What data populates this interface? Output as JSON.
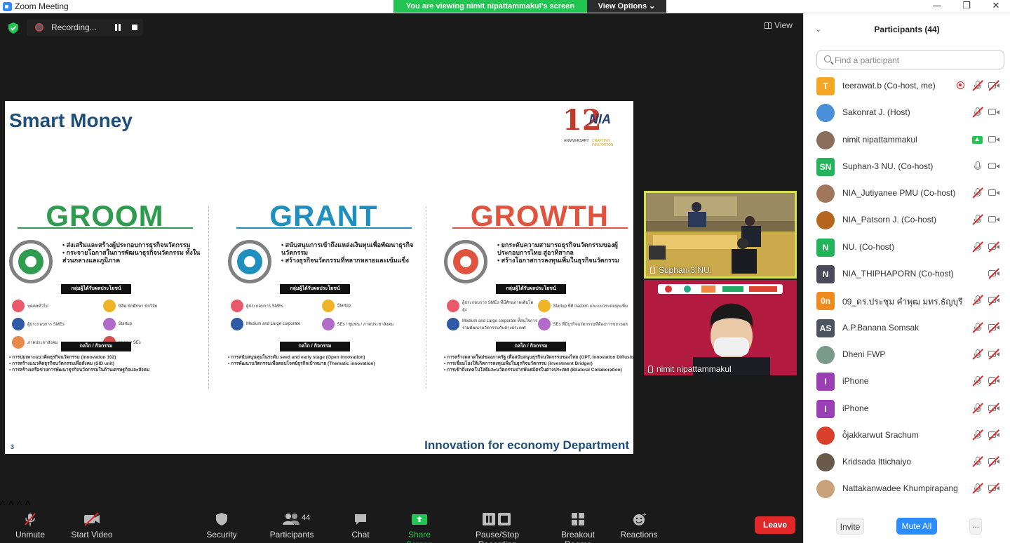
{
  "window": {
    "title": "Zoom Meeting",
    "viewing_banner": "You are viewing nimit nipattammakul's screen",
    "view_options": "View Options ⌄",
    "minimize": "—",
    "maximize": "❐",
    "close": "✕"
  },
  "meeting": {
    "recording_label": "Recording...",
    "view_label": "View"
  },
  "slide": {
    "title": "Smart Money",
    "logo_number": "12",
    "logo_text": "NIA",
    "logo_anniversary": "ANNIVERSARY",
    "logo_tagline": "CRAFTING INNOVATION",
    "slide_number": "3",
    "footer": "Innovation for economy Department",
    "columns": [
      {
        "heading": "GROOM",
        "color": "#2e9b4e",
        "bullets": [
          "ส่งเสริมและสร้างผู้ประกอบการธุรกิจนวัตกรรม",
          "กระจายโอกาสในการพัฒนาธุรกิจนวัตกรรม ทั้งในส่วนกลางและภูมิภาค"
        ],
        "beneficiary_header": "กลุ่มผู้ได้รับผลประโยชน์",
        "beneficiaries": [
          "บุคคลทั่วไป",
          "นิสิต นักศึกษา นักวิจัย",
          "ผู้ประกอบการ SMEs",
          "Startup",
          "ภาคประชาสังคม",
          "ชุมชน / SEs"
        ],
        "mechanism_header": "กลไก / กิจกรรม",
        "mechanisms": [
          "การบ่มเพาะแนวคิดธุรกิจนวัตกรรม (Innovation 102)",
          "การสร้างแนวคิดธุรกิจนวัตกรรมเพื่อสังคม (SID unit)",
          "การสร้างเครือข่ายการพัฒนาธุรกิจนวัตกรรมในด้านเศรษฐกิจและสังคม"
        ]
      },
      {
        "heading": "GRANT",
        "color": "#1f8fbf",
        "bullets": [
          "สนับสนุนการเข้าถึงแหล่งเงินทุนเพื่อพัฒนาธุรกิจนวัตกรรม",
          "สร้างธุรกิจนวัตกรรมที่หลากหลายและเข้มแข็ง"
        ],
        "beneficiary_header": "กลุ่มผู้ได้รับผลประโยชน์",
        "beneficiaries": [
          "ผู้ประกอบการ SMEs",
          "Startup",
          "Medium and Large corporate",
          "SEs / ชุมชน / ภาคประชาสังคม"
        ],
        "mechanism_header": "กลไก / กิจกรรม",
        "mechanisms": [
          "การสนับสนุนทุนในระดับ seed and early stage (Open innovation)",
          "การพัฒนานวัตกรรมเพื่อตอบโจทย์ธุรกิจเป้าหมาย (Thematic innovation)"
        ]
      },
      {
        "heading": "GROWTH",
        "color": "#e0533e",
        "bullets": [
          "ยกระดับความสามารถธุรกิจนวัตกรรมของผู้ประกอบการไทย สู่อาทิสากล",
          "สร้างโอกาสการลงทุนเพิ่มในธุรกิจนวัตกรรม"
        ],
        "beneficiary_header": "กลุ่มผู้ได้รับผลประโยชน์",
        "beneficiaries": [
          "ผู้ประกอบการ SMEs ที่มีศักยภาพเติบโตสูง",
          "Startup ที่มี traction และแนวระดมทุนเพิ่ม",
          "Medium and Large corporate ที่สนใจการร่วมพัฒนานวัตกรรมกับต่างประเทศ",
          "SEs ที่มีธุรกิจนวัตกรรมที่ต้องการขยายผล"
        ],
        "mechanism_header": "กลไก / กิจกรรม",
        "mechanisms": [
          "การสร้างตลาดใหม่ของภาครัฐ เพื่อสนับสนุนธุรกิจนวัตกรรมของไทย (GPT, Innovation Diffusion)",
          "การเชื่อมโยงให้เกิดการลงทุนเพิ่มในธุรกิจนวัตกรรม (Investment Bridger)",
          "การเข้าถึงเทคโนโลยีและนวัตกรรมจากพันธมิตรในต่างประเทศ (Bilateral Collaboration)"
        ]
      }
    ]
  },
  "tiles": [
    {
      "name": "Suphan-3 NU."
    },
    {
      "name": "nimit nipattammakul"
    }
  ],
  "toolbar": {
    "unmute": "Unmute",
    "start_video": "Start Video",
    "security": "Security",
    "participants": "Participants",
    "participants_count": "44",
    "chat": "Chat",
    "share_screen": "Share Screen",
    "pause_stop_recording": "Pause/Stop Recording",
    "breakout_rooms": "Breakout Rooms",
    "reactions": "Reactions",
    "leave": "Leave"
  },
  "participants_panel": {
    "title": "Participants (44)",
    "search_placeholder": "Find a participant",
    "invite": "Invite",
    "mute_all": "Mute All",
    "more": "...",
    "people": [
      {
        "initials": "T",
        "name": "teerawat.b (Co-host, me)",
        "color": "#f5a623",
        "mic": "muted",
        "cam": "off",
        "extra": "record"
      },
      {
        "initials": "",
        "name": "Sakonrat J. (Host)",
        "color": "#4a90d9",
        "mic": "muted",
        "cam": "on",
        "extra": ""
      },
      {
        "initials": "",
        "name": "nimit nipattammakul",
        "color": "#8a6d5a",
        "mic": "share",
        "cam": "on",
        "extra": ""
      },
      {
        "initials": "SN",
        "name": "Suphan-3 NU. (Co-host)",
        "color": "#23b35a",
        "mic": "on",
        "cam": "on",
        "extra": ""
      },
      {
        "initials": "",
        "name": "NIA_Jutiyanee PMU (Co-host)",
        "color": "#a0765c",
        "mic": "muted",
        "cam": "on",
        "extra": ""
      },
      {
        "initials": "",
        "name": "NIA_Patsorn J. (Co-host)",
        "color": "#b5651d",
        "mic": "muted",
        "cam": "on",
        "extra": ""
      },
      {
        "initials": "N",
        "name": "NU. (Co-host)",
        "color": "#23b35a",
        "mic": "muted",
        "cam": "off",
        "extra": ""
      },
      {
        "initials": "N",
        "name": "NIA_THIPHAPORN (Co-host)",
        "color": "#4a4a5a",
        "mic": "none",
        "cam": "off",
        "extra": ""
      },
      {
        "initials": "0n",
        "name": "09_ดร.ประชุม คำพุฒ มทร.ธัญบุรี",
        "color": "#f08a1c",
        "mic": "muted",
        "cam": "off",
        "extra": ""
      },
      {
        "initials": "AS",
        "name": "A.P.Banana Somsak",
        "color": "#4a5560",
        "mic": "muted",
        "cam": "off",
        "extra": ""
      },
      {
        "initials": "",
        "name": "Dheni FWP",
        "color": "#7a9a8a",
        "mic": "muted",
        "cam": "off",
        "extra": ""
      },
      {
        "initials": "I",
        "name": "iPhone",
        "color": "#9b3fb5",
        "mic": "muted",
        "cam": "off",
        "extra": ""
      },
      {
        "initials": "I",
        "name": "iPhone",
        "color": "#9b3fb5",
        "mic": "muted",
        "cam": "off",
        "extra": ""
      },
      {
        "initials": "",
        "name": "ò̂jakkarwut Srachum",
        "color": "#d9402b",
        "mic": "muted",
        "cam": "off",
        "extra": ""
      },
      {
        "initials": "",
        "name": "Kridsada Ittichaiyo",
        "color": "#6a5a4a",
        "mic": "muted",
        "cam": "off",
        "extra": ""
      },
      {
        "initials": "",
        "name": "Nattakanwadee Khumpirapang",
        "color": "#c9a27a",
        "mic": "muted",
        "cam": "off",
        "extra": ""
      }
    ]
  }
}
